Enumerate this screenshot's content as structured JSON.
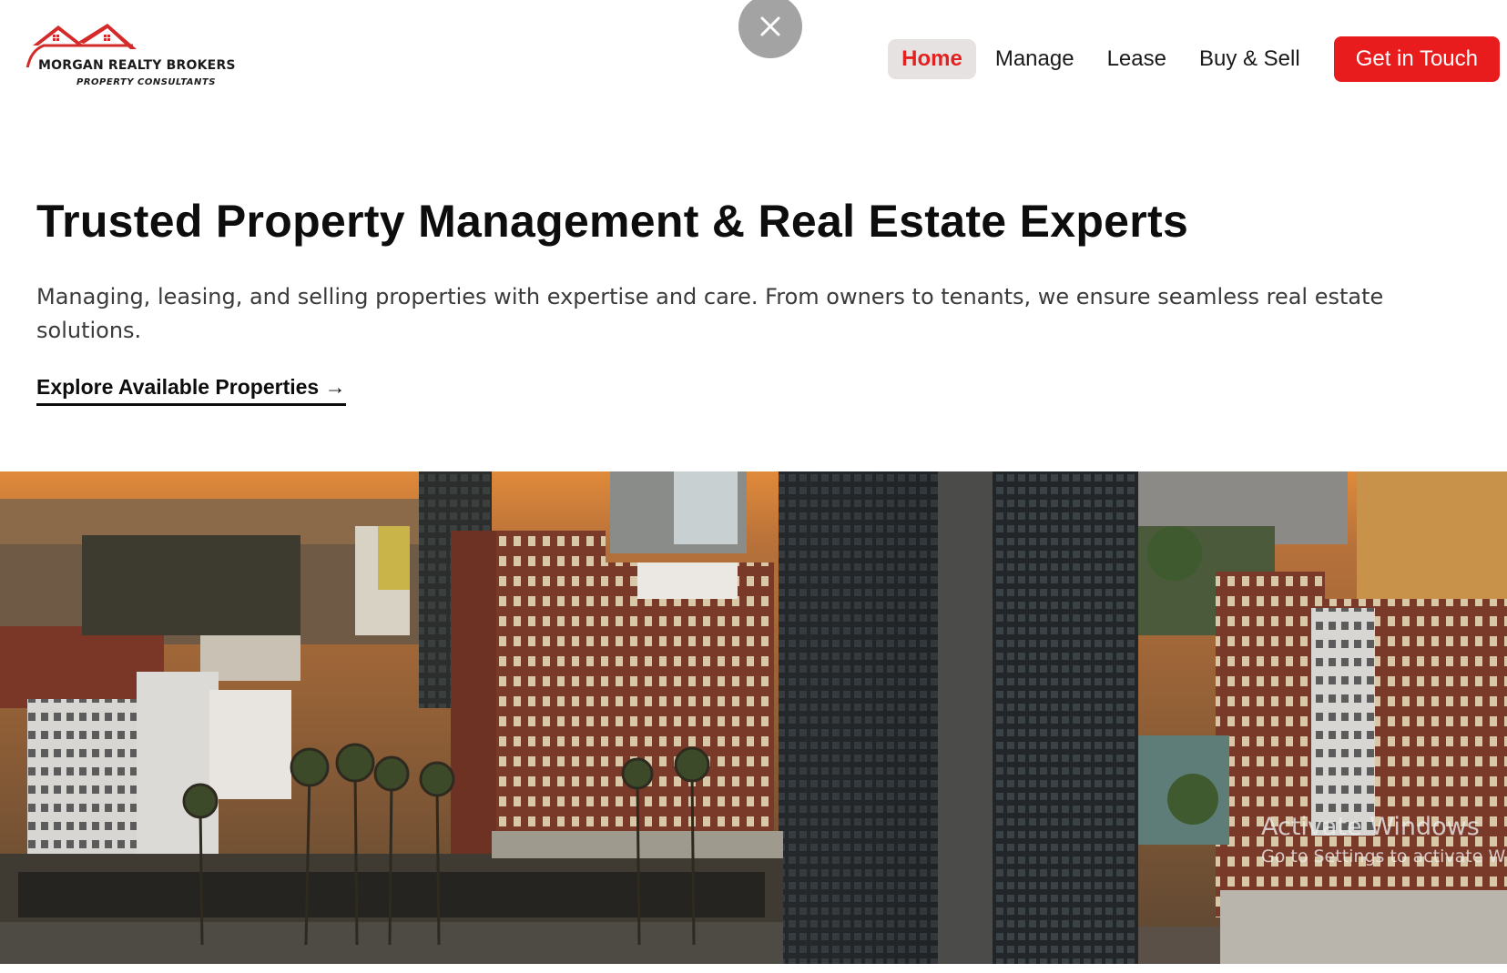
{
  "brand": {
    "name": "MORGAN REALTY BROKERS",
    "tagline": "PROPERTY CONSULTANTS",
    "accent": "#e81c1c"
  },
  "overlay": {
    "close_icon": "close-icon"
  },
  "nav": {
    "items": [
      {
        "label": "Home",
        "active": true
      },
      {
        "label": "Manage",
        "active": false
      },
      {
        "label": "Lease",
        "active": false
      },
      {
        "label": "Buy & Sell",
        "active": false
      }
    ],
    "cta_label": "Get in Touch"
  },
  "hero": {
    "title": "Trusted Property Management & Real Estate Experts",
    "subtitle": "Managing, leasing, and selling properties with expertise and care. From owners to tenants, we ensure seamless real estate solutions.",
    "link_label": "Explore Available Properties →"
  },
  "watermark": {
    "line1": "Activate Windows",
    "line2": "Go to Settings to activate W"
  }
}
